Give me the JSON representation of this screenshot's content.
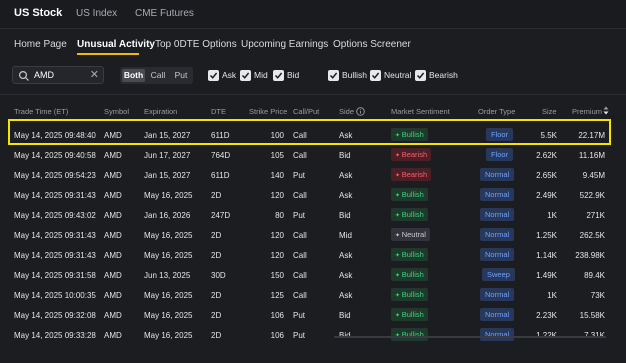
{
  "top_tabs": [
    {
      "label": "US Stock",
      "active": true
    },
    {
      "label": "US Index",
      "active": false
    },
    {
      "label": "CME Futures",
      "active": false
    }
  ],
  "sub_tabs": [
    {
      "label": "Home Page",
      "active": false
    },
    {
      "label": "Unusual Activity",
      "active": true
    },
    {
      "label": "Top 0DTE Options",
      "active": false
    },
    {
      "label": "Upcoming Earnings",
      "active": false
    },
    {
      "label": "Options Screener",
      "active": false
    }
  ],
  "filters": {
    "search": {
      "value": "AMD",
      "icon": "search-icon"
    },
    "segment": [
      {
        "label": "Both",
        "active": true
      },
      {
        "label": "Call",
        "active": false
      },
      {
        "label": "Put",
        "active": false
      }
    ],
    "checkboxes": [
      {
        "label": "Ask",
        "checked": true
      },
      {
        "label": "Mid",
        "checked": true
      },
      {
        "label": "Bid",
        "checked": true
      },
      {
        "label": "Bullish",
        "checked": true
      },
      {
        "label": "Neutral",
        "checked": true
      },
      {
        "label": "Bearish",
        "checked": true
      }
    ]
  },
  "table": {
    "headers": [
      "Trade Time (ET)",
      "Symbol",
      "Expiration",
      "DTE",
      "Strike Price",
      "Call/Put",
      "Side",
      "Market Sentiment",
      "Order Type",
      "Size",
      "Premium"
    ],
    "rows": [
      {
        "time": "May 14, 2025 09:48:40",
        "symbol": "AMD",
        "exp": "Jan 15, 2027",
        "dte": "611D",
        "strike": "100",
        "cp": "Call",
        "side": "Ask",
        "sentiment": "Bullish",
        "otype": "Floor",
        "size": "5.5K",
        "premium": "22.17M"
      },
      {
        "time": "May 14, 2025 09:40:58",
        "symbol": "AMD",
        "exp": "Jun 17, 2027",
        "dte": "764D",
        "strike": "105",
        "cp": "Call",
        "side": "Bid",
        "sentiment": "Bearish",
        "otype": "Floor",
        "size": "2.62K",
        "premium": "11.16M"
      },
      {
        "time": "May 14, 2025 09:54:23",
        "symbol": "AMD",
        "exp": "Jan 15, 2027",
        "dte": "611D",
        "strike": "140",
        "cp": "Put",
        "side": "Ask",
        "sentiment": "Bearish",
        "otype": "Normal",
        "size": "2.65K",
        "premium": "9.45M"
      },
      {
        "time": "May 14, 2025 09:31:43",
        "symbol": "AMD",
        "exp": "May 16, 2025",
        "dte": "2D",
        "strike": "120",
        "cp": "Call",
        "side": "Ask",
        "sentiment": "Bullish",
        "otype": "Normal",
        "size": "2.49K",
        "premium": "522.9K"
      },
      {
        "time": "May 14, 2025 09:43:02",
        "symbol": "AMD",
        "exp": "Jan 16, 2026",
        "dte": "247D",
        "strike": "80",
        "cp": "Put",
        "side": "Bid",
        "sentiment": "Bullish",
        "otype": "Normal",
        "size": "1K",
        "premium": "271K"
      },
      {
        "time": "May 14, 2025 09:31:43",
        "symbol": "AMD",
        "exp": "May 16, 2025",
        "dte": "2D",
        "strike": "120",
        "cp": "Call",
        "side": "Mid",
        "sentiment": "Neutral",
        "otype": "Normal",
        "size": "1.25K",
        "premium": "262.5K"
      },
      {
        "time": "May 14, 2025 09:31:43",
        "symbol": "AMD",
        "exp": "May 16, 2025",
        "dte": "2D",
        "strike": "120",
        "cp": "Call",
        "side": "Ask",
        "sentiment": "Bullish",
        "otype": "Normal",
        "size": "1.14K",
        "premium": "238.98K"
      },
      {
        "time": "May 14, 2025 09:31:58",
        "symbol": "AMD",
        "exp": "Jun 13, 2025",
        "dte": "30D",
        "strike": "150",
        "cp": "Call",
        "side": "Ask",
        "sentiment": "Bullish",
        "otype": "Sweep",
        "size": "1.49K",
        "premium": "89.4K"
      },
      {
        "time": "May 14, 2025 10:00:35",
        "symbol": "AMD",
        "exp": "May 16, 2025",
        "dte": "2D",
        "strike": "125",
        "cp": "Call",
        "side": "Ask",
        "sentiment": "Bullish",
        "otype": "Normal",
        "size": "1K",
        "premium": "73K"
      },
      {
        "time": "May 14, 2025 09:32:08",
        "symbol": "AMD",
        "exp": "May 16, 2025",
        "dte": "2D",
        "strike": "106",
        "cp": "Put",
        "side": "Bid",
        "sentiment": "Bullish",
        "otype": "Normal",
        "size": "2.23K",
        "premium": "15.58K"
      },
      {
        "time": "May 14, 2025 09:33:28",
        "symbol": "AMD",
        "exp": "May 16, 2025",
        "dte": "2D",
        "strike": "106",
        "cp": "Put",
        "side": "Bid",
        "sentiment": "Bullish",
        "otype": "Normal",
        "size": "1.22K",
        "premium": "7.31K"
      }
    ]
  },
  "colors": {
    "bullish": "#3ccf7a",
    "bearish": "#ff5c6c",
    "highlight": "#f5e400",
    "accent": "#f0b90b"
  }
}
